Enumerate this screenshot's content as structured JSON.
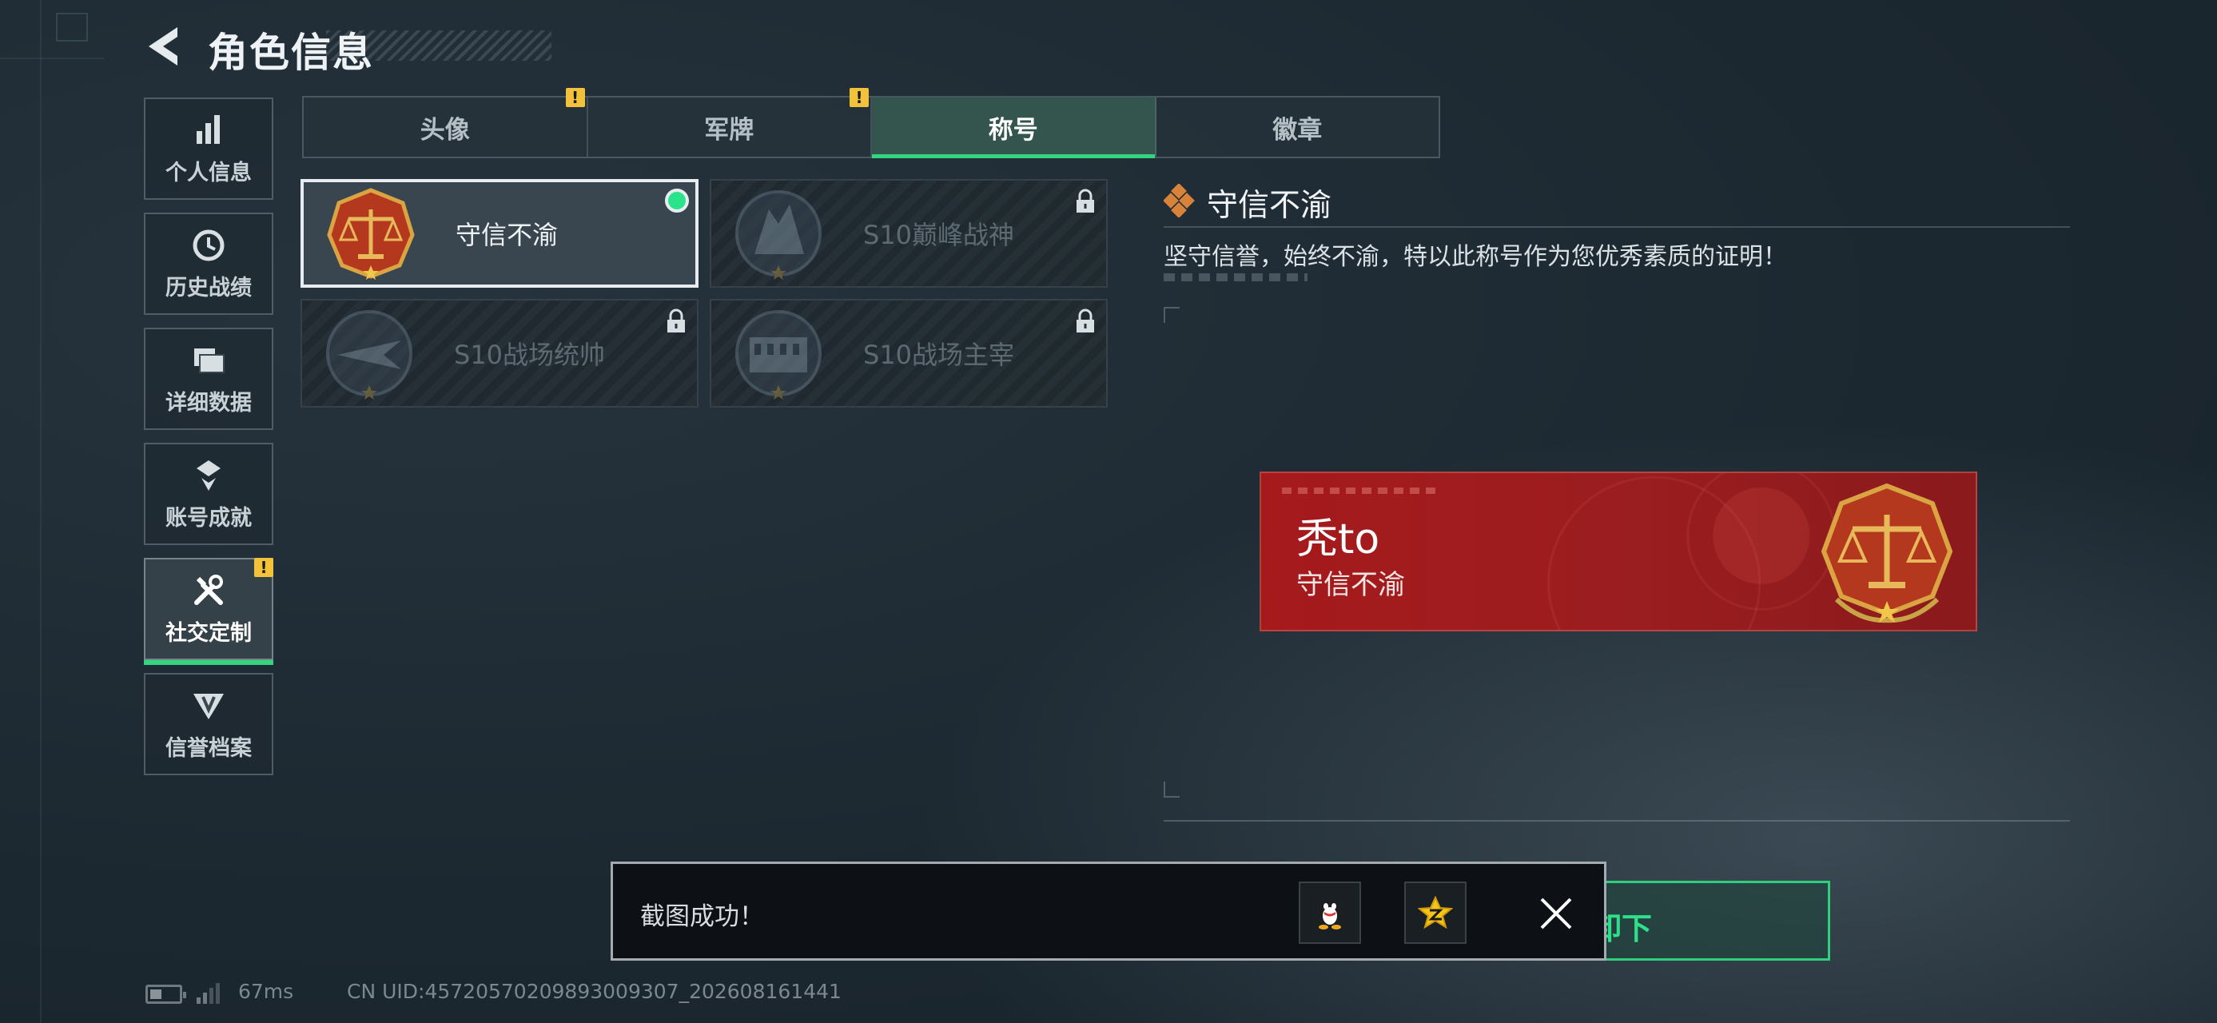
{
  "header": {
    "title": "角色信息"
  },
  "sidebar": {
    "items": [
      {
        "label": "个人信息",
        "icon": "bar-chart-icon"
      },
      {
        "label": "历史战绩",
        "icon": "clock-icon"
      },
      {
        "label": "详细数据",
        "icon": "folder-icon"
      },
      {
        "label": "账号成就",
        "icon": "achievement-medal-icon"
      },
      {
        "label": "社交定制",
        "icon": "tools-icon",
        "active": true,
        "badge": "!"
      },
      {
        "label": "信誉档案",
        "icon": "shield-wings-icon"
      }
    ]
  },
  "tabs": [
    {
      "label": "头像",
      "badge": "!"
    },
    {
      "label": "军牌",
      "badge": "!"
    },
    {
      "label": "称号",
      "active": true
    },
    {
      "label": "徽章"
    }
  ],
  "title_cards": [
    {
      "label": "守信不渝",
      "selected": true,
      "locked": false
    },
    {
      "label": "S10巅峰战神",
      "selected": false,
      "locked": true
    },
    {
      "label": "S10战场统帅",
      "selected": false,
      "locked": true
    },
    {
      "label": "S10战场主宰",
      "selected": false,
      "locked": true
    }
  ],
  "detail": {
    "title": "守信不渝",
    "description": "坚守信誉，始终不渝，特以此称号作为您优秀素质的证明！"
  },
  "name_plate": {
    "player_name": "秃to",
    "title": "守信不渝"
  },
  "action": {
    "remove_label": "卸下"
  },
  "toast": {
    "message": "截图成功！",
    "share_targets": [
      "qq-penguin-icon",
      "qzone-star-icon"
    ]
  },
  "footer": {
    "ping": "67ms",
    "uid": "CN UID:4572057020989300930​7_202608161441"
  },
  "colors": {
    "accent_green": "#33d67f",
    "warn_yellow": "#f2c23a",
    "plate_red": "#a61a1c",
    "emblem_gold": "#d9a441"
  }
}
